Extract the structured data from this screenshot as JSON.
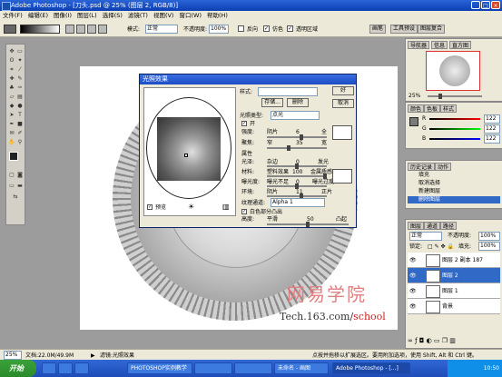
{
  "window": {
    "title": "Adobe Photoshop - [刀头.psd @ 25% (图层 2, RGB/8)]",
    "min": "_",
    "max": "□",
    "close": "×"
  },
  "menu": [
    "文件(F)",
    "编辑(E)",
    "图像(I)",
    "图层(L)",
    "选择(S)",
    "滤镜(T)",
    "视图(V)",
    "窗口(W)",
    "帮助(H)"
  ],
  "options": {
    "mode_label": "模式:",
    "mode_value": "正常",
    "opacity_label": "不透明度:",
    "opacity_value": "100%",
    "reverse": "反向",
    "dither": "仿色",
    "transparency": "透明区域",
    "tabs": [
      "画笔",
      "工具预设",
      "图层复合"
    ]
  },
  "dialog": {
    "title": "光照效果",
    "style_label": "样式:",
    "ok": "好",
    "save": "存储...",
    "delete": "删除",
    "cancel": "取消",
    "light_type_label": "光照类型:",
    "light_type_value": "点光",
    "on": "开",
    "intensity_label": "强度:",
    "intensity_left": "阴片",
    "intensity_val": "6",
    "intensity_right": "全",
    "focus_label": "聚焦:",
    "focus_left": "窄",
    "focus_val": "35",
    "focus_right": "宽",
    "properties_label": "属性",
    "gloss_label": "光泽:",
    "gloss_left": "杂边",
    "gloss_val": "0",
    "gloss_right": "发光",
    "material_label": "材料:",
    "material_left": "塑料效果",
    "material_val": "100",
    "material_right": "金属质感",
    "exposure_label": "曝光度:",
    "exposure_left": "曝光不足",
    "exposure_val": "0",
    "exposure_right": "曝光过度",
    "ambience_label": "环境:",
    "ambience_left": "阴片",
    "ambience_val": "11",
    "ambience_right": "正片",
    "texture_label": "纹理通道:",
    "texture_value": "Alpha 1",
    "white_high": "白色部分凸出",
    "height_label": "高度:",
    "height_left": "平滑",
    "height_val": "50",
    "height_right": "凸起",
    "preview": "预览"
  },
  "navigator": {
    "tabs": [
      "导航器",
      "信息",
      "直方图"
    ],
    "zoom": "25%"
  },
  "color": {
    "tabs": [
      "颜色",
      "色板",
      "样式"
    ],
    "r_label": "R",
    "r_value": "122",
    "g_label": "G",
    "g_value": "122",
    "b_label": "B",
    "b_value": "122"
  },
  "history": {
    "tabs": [
      "历史记录",
      "动作"
    ],
    "items": [
      "填充",
      "取消选择",
      "新建图层",
      "删除图层"
    ]
  },
  "layers": {
    "tabs": [
      "图层",
      "通道",
      "路径"
    ],
    "blend": "正常",
    "opacity_label": "不透明度:",
    "opacity_value": "100%",
    "lock_label": "锁定:",
    "fill_label": "填充:",
    "fill_value": "100%",
    "rows": [
      "图层 2 副本 187",
      "图层 2",
      "图层 1",
      "背景"
    ]
  },
  "status": {
    "zoom": "25%",
    "doc": "文档:22.0M/49.9M",
    "tool": "滤镜:光照效果",
    "hint": "点按并拖移以扩展选区。要用附加选项，使用 Shift, Alt 和 Ctrl 键。"
  },
  "taskbar": {
    "start": "开始",
    "items": [
      "PHOTOSHOP实例教学",
      "",
      "",
      "",
      "未命名 - 画图",
      "Adobe Photoshop - [...]",
      "",
      ""
    ],
    "time": "10:50"
  },
  "watermark": {
    "cn": "网易学院",
    "url_prefix": "Tech.163.com/",
    "url_suffix": "school"
  }
}
